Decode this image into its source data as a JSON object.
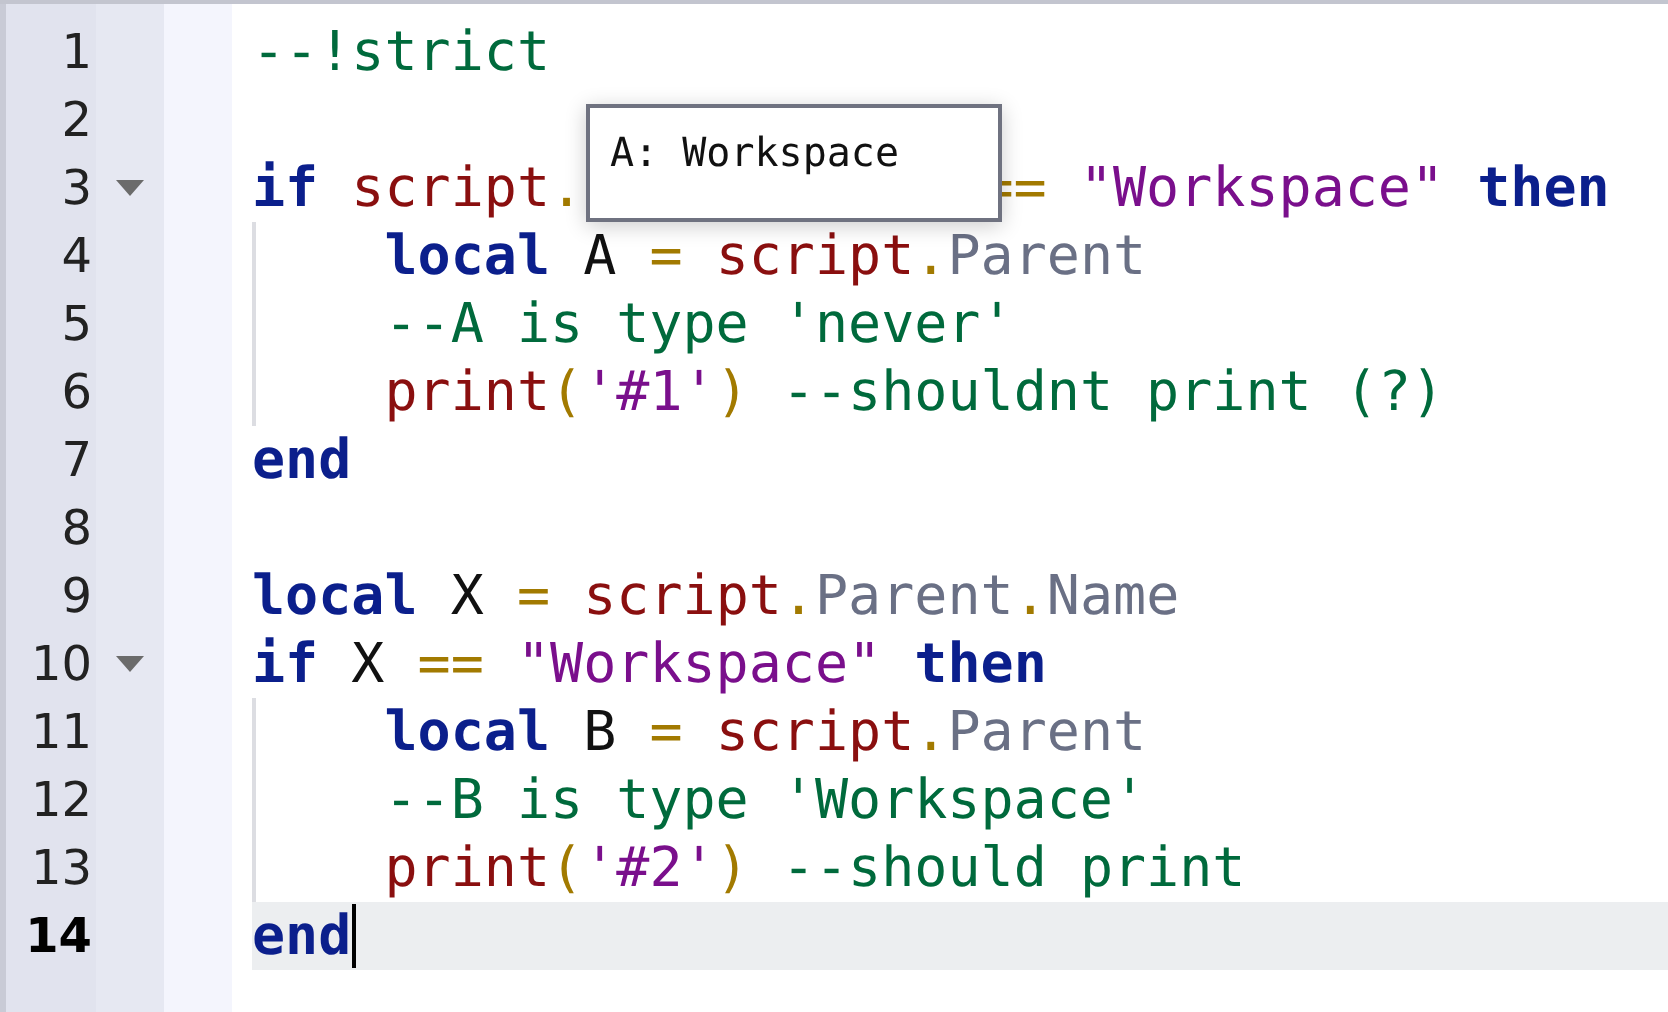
{
  "tooltip": {
    "text": "A: Workspace"
  },
  "lines": [
    {
      "number": "1",
      "tokens": [
        {
          "kind": "comment",
          "text": "--!strict"
        }
      ]
    },
    {
      "number": "2"
    },
    {
      "number": "3",
      "expanded": true,
      "tokens": [
        {
          "kind": "keyword",
          "text": "if "
        },
        {
          "kind": "global",
          "text": "script"
        },
        {
          "kind": "operator",
          "text": "."
        },
        {
          "kind": "covered"
        },
        {
          "kind": "operator",
          "text": "== "
        },
        {
          "kind": "string",
          "text": "\"Workspace\" "
        },
        {
          "kind": "keyword",
          "text": "then"
        }
      ],
      "children": [
        {
          "number": "4",
          "tokens": [
            {
              "kind": "keyword",
              "text": "local"
            },
            {
              "kind": "plain",
              "text": " A "
            },
            {
              "kind": "operator",
              "text": "= "
            },
            {
              "kind": "global",
              "text": "script"
            },
            {
              "kind": "operator",
              "text": "."
            },
            {
              "kind": "member",
              "text": "Parent"
            }
          ]
        },
        {
          "number": "5",
          "tokens": [
            {
              "kind": "comment",
              "text": "--A is type 'never'"
            }
          ]
        },
        {
          "number": "6",
          "tokens": [
            {
              "kind": "global",
              "text": "print"
            },
            {
              "kind": "operator",
              "text": "("
            },
            {
              "kind": "string",
              "text": "'#1'"
            },
            {
              "kind": "operator",
              "text": ") "
            },
            {
              "kind": "comment",
              "text": "--shouldnt print (?)"
            }
          ]
        }
      ]
    },
    {
      "number": "7",
      "tokens": [
        {
          "kind": "keyword",
          "text": "end"
        }
      ]
    },
    {
      "number": "8"
    },
    {
      "number": "9",
      "tokens": [
        {
          "kind": "keyword",
          "text": "local"
        },
        {
          "kind": "plain",
          "text": " X "
        },
        {
          "kind": "operator",
          "text": "= "
        },
        {
          "kind": "global",
          "text": "script"
        },
        {
          "kind": "operator",
          "text": "."
        },
        {
          "kind": "member",
          "text": "Parent"
        },
        {
          "kind": "operator",
          "text": "."
        },
        {
          "kind": "member",
          "text": "Name"
        }
      ]
    },
    {
      "number": "10",
      "expanded": true,
      "tokens": [
        {
          "kind": "keyword",
          "text": "if"
        },
        {
          "kind": "plain",
          "text": " X "
        },
        {
          "kind": "operator",
          "text": "== "
        },
        {
          "kind": "string",
          "text": "\"Workspace\" "
        },
        {
          "kind": "keyword",
          "text": "then"
        }
      ],
      "children": [
        {
          "number": "11",
          "tokens": [
            {
              "kind": "keyword",
              "text": "local"
            },
            {
              "kind": "plain",
              "text": " B "
            },
            {
              "kind": "operator",
              "text": "= "
            },
            {
              "kind": "global",
              "text": "script"
            },
            {
              "kind": "operator",
              "text": "."
            },
            {
              "kind": "member",
              "text": "Parent"
            }
          ]
        },
        {
          "number": "12",
          "tokens": [
            {
              "kind": "comment",
              "text": "--B is type 'Workspace'"
            }
          ]
        },
        {
          "number": "13",
          "tokens": [
            {
              "kind": "global",
              "text": "print"
            },
            {
              "kind": "operator",
              "text": "("
            },
            {
              "kind": "string",
              "text": "'#2'"
            },
            {
              "kind": "operator",
              "text": ") "
            },
            {
              "kind": "comment",
              "text": "--should print"
            }
          ]
        }
      ]
    },
    {
      "number": "14",
      "current": true,
      "tokens": [
        {
          "kind": "keyword",
          "text": "end"
        }
      ]
    }
  ]
}
